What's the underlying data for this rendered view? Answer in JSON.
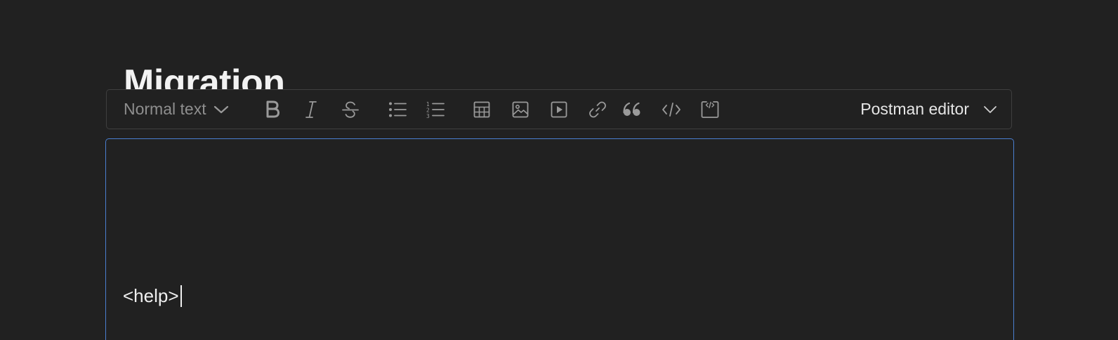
{
  "document": {
    "title": "Migration"
  },
  "toolbar": {
    "text_style": {
      "selected": "Normal text",
      "icon": "chevron-down-icon"
    },
    "buttons": [
      {
        "name": "bold",
        "icon": "bold-icon"
      },
      {
        "name": "italic",
        "icon": "italic-icon"
      },
      {
        "name": "strikethrough",
        "icon": "strikethrough-icon"
      },
      {
        "name": "bulleted-list",
        "icon": "bulleted-list-icon"
      },
      {
        "name": "numbered-list",
        "icon": "numbered-list-icon"
      },
      {
        "name": "table",
        "icon": "table-icon"
      },
      {
        "name": "image",
        "icon": "image-icon"
      },
      {
        "name": "video",
        "icon": "video-icon"
      },
      {
        "name": "link",
        "icon": "link-icon"
      },
      {
        "name": "quote",
        "icon": "quote-icon"
      },
      {
        "name": "inline-code",
        "icon": "code-icon"
      },
      {
        "name": "code-block",
        "icon": "code-block-icon"
      }
    ],
    "editor_mode": {
      "selected": "Postman editor",
      "icon": "chevron-down-icon"
    }
  },
  "editor": {
    "content": "<help>",
    "focused": true
  },
  "colors": {
    "background": "#212121",
    "toolbar_border": "#3f3f3f",
    "focus_border": "#4a7fd1",
    "icon": "#9a9a9a",
    "muted_text": "#8e8e8e",
    "text": "#efefef"
  }
}
